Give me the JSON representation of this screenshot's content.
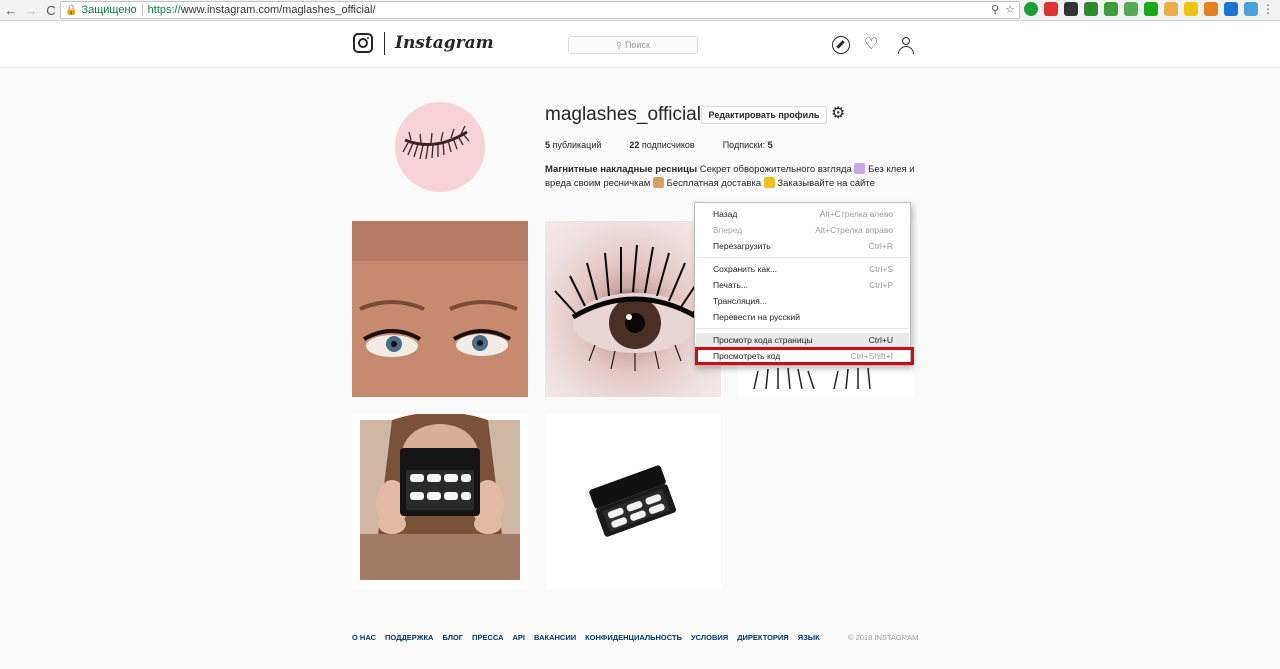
{
  "browser": {
    "secure_label": "Защищено",
    "url_scheme": "https://",
    "url_rest": "www.instagram.com/maglashes_official/",
    "back": "←",
    "forward": "→",
    "reload": "C",
    "search_icon": "search-icon",
    "star_icon": "star-icon"
  },
  "header": {
    "wordmark": "Instagram",
    "search_placeholder": "Поиск"
  },
  "profile": {
    "username": "maglashes_official",
    "edit_button": "Редактировать профиль",
    "stats": {
      "posts_count": "5",
      "posts_label": "публикаций",
      "followers_count": "22",
      "followers_label": "подписчиков",
      "following_label": "Подписки:",
      "following_count": "5"
    },
    "bio_bold": "Магнитные накладные ресницы",
    "bio_part1": " Секрет обворожительного взгляда ",
    "bio_part2": " Без клея и вреда своим ресничкам ",
    "bio_part3": " Бесплатная доставка ",
    "bio_part4": " Заказывайте на сайте"
  },
  "context_menu": {
    "items": [
      {
        "label": "Назад",
        "shortcut": "Alt+Стрелка влево"
      },
      {
        "label": "Вперед",
        "shortcut": "Alt+Стрелка вправо"
      },
      {
        "label": "Перезагрузить",
        "shortcut": "Ctrl+R"
      },
      {
        "label": "Сохранить как...",
        "shortcut": "Ctrl+S"
      },
      {
        "label": "Печать...",
        "shortcut": "Ctrl+P"
      },
      {
        "label": "Трансляция...",
        "shortcut": ""
      },
      {
        "label": "Перевести на русский",
        "shortcut": ""
      },
      {
        "label": "Просмотр кода страницы",
        "shortcut": "Ctrl+U"
      },
      {
        "label": "Просмотреть код",
        "shortcut": "Ctrl+Shift+I"
      }
    ]
  },
  "footer": {
    "links": [
      "О НАС",
      "ПОДДЕРЖКА",
      "БЛОГ",
      "ПРЕССА",
      "API",
      "ВАКАНСИИ",
      "КОНФИДЕНЦИАЛЬНОСТЬ",
      "УСЛОВИЯ",
      "ДИРЕКТОРИЯ",
      "ЯЗЫК"
    ],
    "copyright": "© 2018 INSTAGRAM"
  },
  "colors": {
    "highlight": "#d10b10",
    "link": "#003569",
    "secure": "#0b8043"
  }
}
